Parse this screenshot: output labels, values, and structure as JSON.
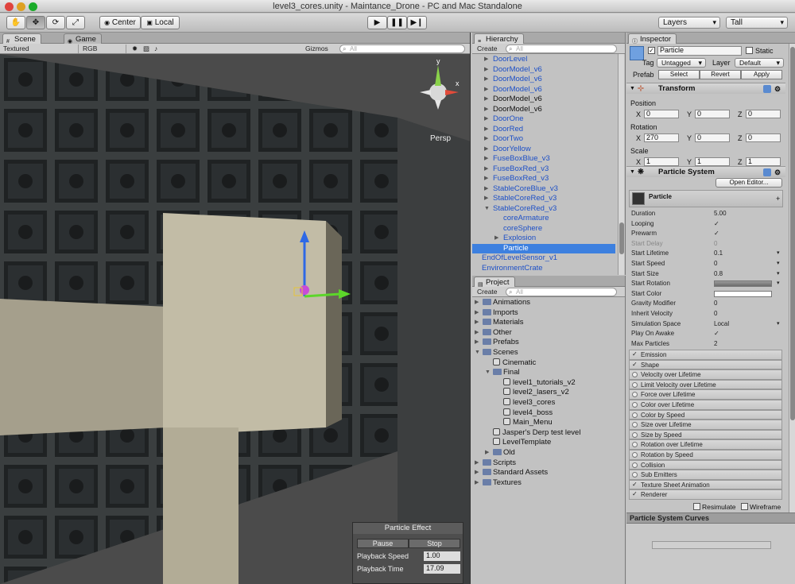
{
  "window": {
    "title": "level3_cores.unity - Maintance_Drone - PC and Mac Standalone"
  },
  "toolbar": {
    "pivot_center": "Center",
    "pivot_local": "Local",
    "layers": "Layers",
    "layout": "Tall"
  },
  "scene": {
    "tab_scene": "Scene",
    "tab_game": "Game",
    "shading": "Textured",
    "render": "RGB",
    "gizmos": "Gizmos",
    "search_placeholder": "All",
    "persp": "Persp",
    "gizmo_y": "y",
    "gizmo_x": "x"
  },
  "particle_effect": {
    "title": "Particle Effect",
    "pause": "Pause",
    "stop": "Stop",
    "speed_label": "Playback Speed",
    "speed_value": "1.00",
    "time_label": "Playback Time",
    "time_value": "17.09"
  },
  "hierarchy": {
    "title": "Hierarchy",
    "create": "Create",
    "search": "All",
    "items": [
      "DoorLevel",
      "DoorModel_v6",
      "DoorModel_v6",
      "DoorModel_v6",
      "DoorModel_v6",
      "DoorModel_v6",
      "DoorOne",
      "DoorRed",
      "DoorTwo",
      "DoorYellow",
      "FuseBoxBlue_v3",
      "FuseBoxRed_v3",
      "FuseBoxRed_v3",
      "StableCoreBlue_v3",
      "StableCoreRed_v3",
      "StableCoreRed_v3",
      "coreArmature",
      "coreSphere",
      "Explosion",
      "Particle",
      "EndOfLevelSensor_v1",
      "EnvironmentCrate"
    ]
  },
  "project": {
    "title": "Project",
    "create": "Create",
    "search": "All",
    "items": [
      "Animations",
      "Imports",
      "Materials",
      "Other",
      "Prefabs",
      "Scenes",
      "Cinematic",
      "Final",
      "level1_tutorials_v2",
      "level2_lasers_v2",
      "level3_cores",
      "level4_boss",
      "Main_Menu",
      "Jasper's Derp test level",
      "LevelTemplate",
      "Old",
      "Scripts",
      "Standard Assets",
      "Textures"
    ]
  },
  "inspector": {
    "title": "Inspector",
    "name": "Particle",
    "static": "Static",
    "tag_label": "Tag",
    "tag": "Untagged",
    "layer_label": "Layer",
    "layer": "Default",
    "prefab": "Prefab",
    "select": "Select",
    "revert": "Revert",
    "apply": "Apply",
    "transform": "Transform",
    "position": "Position",
    "rotation": "Rotation",
    "scale": "Scale",
    "pos": [
      "0",
      "0",
      "0"
    ],
    "rot": [
      "270",
      "0",
      "0"
    ],
    "scl": [
      "1",
      "1",
      "1"
    ],
    "x": "X",
    "y": "Y",
    "z": "Z",
    "ps": "Particle System",
    "open_editor": "Open Editor...",
    "ps_name": "Particle",
    "props": [
      [
        "Duration",
        "5.00"
      ],
      [
        "Looping",
        "✓"
      ],
      [
        "Prewarm",
        "✓"
      ],
      [
        "Start Delay",
        "0"
      ],
      [
        "Start Lifetime",
        "0.1"
      ],
      [
        "Start Speed",
        "0"
      ],
      [
        "Start Size",
        "0.8"
      ],
      [
        "Start Rotation",
        ""
      ],
      [
        "Start Color",
        ""
      ],
      [
        "Gravity Modifier",
        "0"
      ],
      [
        "Inherit Velocity",
        "0"
      ],
      [
        "Simulation Space",
        "Local"
      ],
      [
        "Play On Awake",
        "✓"
      ],
      [
        "Max Particles",
        "2"
      ]
    ],
    "modules": [
      "Emission",
      "Shape",
      "Velocity over Lifetime",
      "Limit Velocity over Lifetime",
      "Force over Lifetime",
      "Color over Lifetime",
      "Color by Speed",
      "Size over Lifetime",
      "Size by Speed",
      "Rotation over Lifetime",
      "Rotation by Speed",
      "Collision",
      "Sub Emitters",
      "Texture Sheet Animation",
      "Renderer"
    ],
    "modules_checked": [
      true,
      true,
      false,
      false,
      false,
      false,
      false,
      false,
      false,
      false,
      false,
      false,
      false,
      true,
      true
    ],
    "resimulate": "Resimulate",
    "wireframe": "Wireframe",
    "curves": "Particle System Curves"
  },
  "colors": {
    "selection": "#3d80df",
    "link": "#1c4fc7",
    "panel": "#c2c2c2"
  }
}
